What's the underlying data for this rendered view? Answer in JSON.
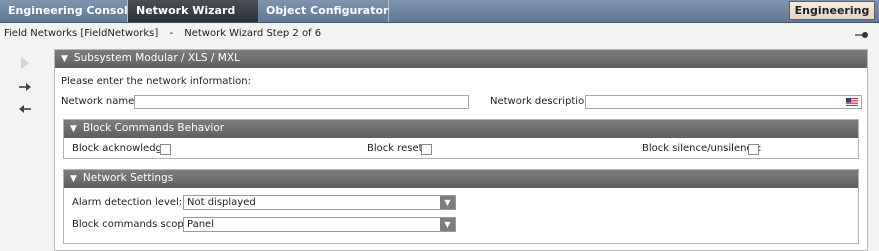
{
  "tabs": [
    {
      "label": "Engineering Console"
    },
    {
      "label": "Network Wizard"
    },
    {
      "label": "Object Configurator"
    }
  ],
  "mode_button": "Engineering",
  "breadcrumb": {
    "path": "Field Networks [FieldNetworks]",
    "separator": "-",
    "step": "Network Wizard Step 2 of 6"
  },
  "toolbar": {
    "play_icon": "play-icon",
    "next_icon": "arrow-right-icon",
    "back_icon": "arrow-left-icon"
  },
  "panel": {
    "title": "Subsystem Modular / XLS / MXL",
    "prompt": "Please enter the network information:",
    "network_name_label": "Network name:",
    "network_name_value": "",
    "network_description_label": "Network description:",
    "network_description_value": "",
    "block_section": {
      "title": "Block Commands Behavior",
      "acknowledge_label": "Block acknowledge:",
      "reset_label": "Block reset:",
      "silence_label": "Block silence/unsilence:"
    },
    "network_settings": {
      "title": "Network Settings",
      "alarm_label": "Alarm detection level:",
      "alarm_value": "Not displayed",
      "scope_label": "Block commands scope:",
      "scope_value": "Panel"
    }
  },
  "colors": {
    "header_gray": "#6e6e6e",
    "tab_bar": "#6d86a3",
    "active_tab": "#3a3e44"
  }
}
